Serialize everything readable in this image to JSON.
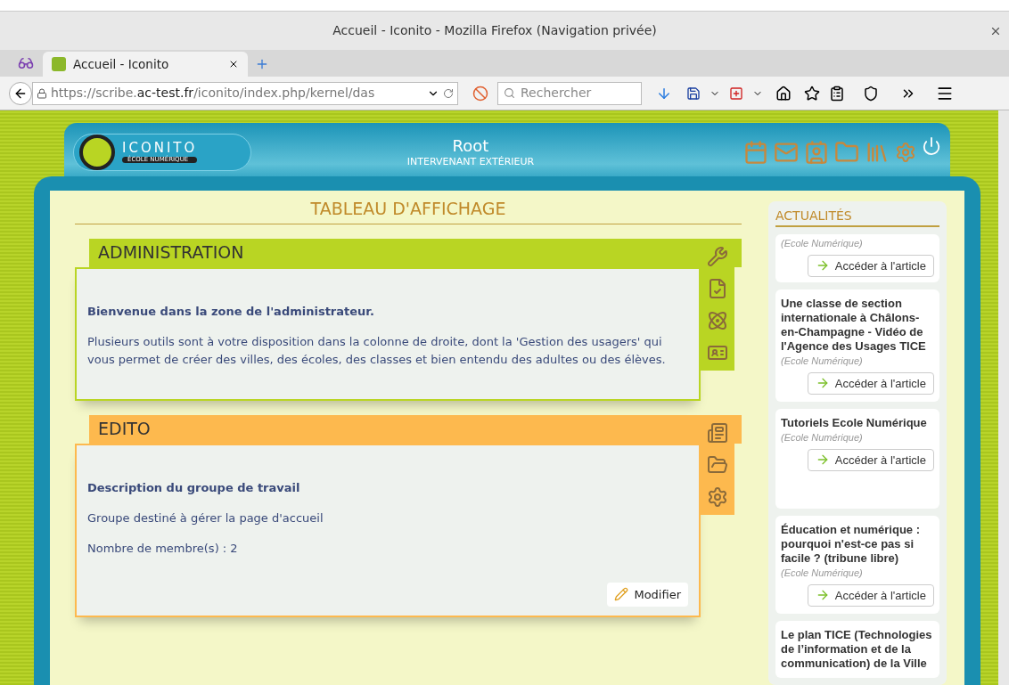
{
  "browser": {
    "window_title": "Accueil - Iconito - Mozilla Firefox (Navigation privée)",
    "tab": {
      "title": "Accueil - Iconito",
      "selected": true
    },
    "url": {
      "host_prefix": "https://scribe.",
      "domain": "ac-test.fr",
      "path": "/iconito/index.php/kernel/das"
    },
    "search": {
      "placeholder": "Rechercher"
    }
  },
  "header": {
    "logo": {
      "name": "ICONITO",
      "subtitle": "ÉCOLE NUMÉRIQUE"
    },
    "user": {
      "name": "Root",
      "role": "INTERVENANT EXTÉRIEUR"
    }
  },
  "main": {
    "title": "TABLEAU D'AFFICHAGE",
    "panels": [
      {
        "kind": "admin",
        "title": "ADMINISTRATION",
        "color": "#b9d523",
        "paragraphs": [
          {
            "text": "Bienvenue dans la zone de l'administrateur.",
            "bold": true
          },
          {
            "text": "Plusieurs outils sont à votre disposition dans la colonne de droite, dont la 'Gestion des usagers' qui vous permet de créer des villes, des écoles, des classes et bien entendu des adultes ou des élèves.",
            "bold": false
          }
        ]
      },
      {
        "kind": "edito",
        "title": "EDITO",
        "color": "#fdb94e",
        "paragraphs": [
          {
            "text": "Description du groupe de travail",
            "bold": true
          },
          {
            "text": "Groupe destiné à gérer la page d'accueil",
            "bold": false
          },
          {
            "text": "Nombre de membre(s) : 2",
            "bold": false
          }
        ],
        "button": "Modifier"
      }
    ]
  },
  "news": {
    "title": "ACTUALITÉS",
    "items": [
      {
        "source": "(Ecole Numérique)",
        "button": "Accéder à l'article"
      },
      {
        "title": "Une classe de section internationale à Châlons-en-Champagne - Vidéo de l'Agence des Usages TICE",
        "source": "(Ecole Numérique)",
        "button": "Accéder à l'article"
      },
      {
        "title": "Tutoriels Ecole Numérique",
        "source": "(Ecole Numérique)",
        "button": "Accéder à l'article"
      },
      {
        "title": "Éducation et numérique : pourquoi n'est-ce pas si facile ? (tribune libre)",
        "source": "(Ecole Numérique)",
        "button": "Accéder à l'article"
      },
      {
        "title": "Le plan TICE (Technologies de l’information et de la communication) de la Ville"
      }
    ]
  }
}
